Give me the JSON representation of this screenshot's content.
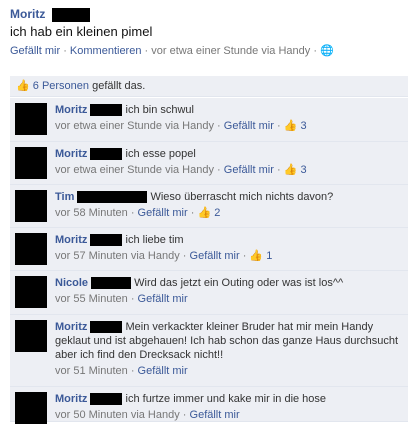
{
  "post": {
    "author": "Moritz",
    "text": "ich hab ein kleinen pimel",
    "like_action": "Gefällt mir",
    "comment_action": "Kommentieren",
    "time": "vor etwa einer Stunde via Handy"
  },
  "likes_summary": {
    "count_link": "6 Personen",
    "suffix": "gefällt das."
  },
  "comments": [
    {
      "author": "Moritz",
      "text": "ich bin schwul",
      "time": "vor etwa einer Stunde via Handy",
      "like": "Gefällt mir",
      "likes": "3"
    },
    {
      "author": "Moritz",
      "text": "ich esse popel",
      "time": "vor etwa einer Stunde via Handy",
      "like": "Gefällt mir",
      "likes": "3"
    },
    {
      "author": "Tim",
      "text": "Wieso überrascht mich nichts davon?",
      "time": "vor 58 Minuten",
      "like": "Gefällt mir",
      "likes": "2"
    },
    {
      "author": "Moritz",
      "text": "ich liebe tim",
      "time": "vor 57 Minuten via Handy",
      "like": "Gefällt mir",
      "likes": "1"
    },
    {
      "author": "Nicole",
      "text": "Wird das jetzt ein Outing oder was ist los^^",
      "time": "vor 55 Minuten",
      "like": "Gefällt mir",
      "likes": ""
    },
    {
      "author": "Moritz",
      "text": "Mein verkackter kleiner Bruder hat mir mein Handy geklaut und ist abgehauen! Ich hab schon das ganze Haus durchsucht aber ich find den Drecksack nicht!!",
      "time": "vor 51 Minuten",
      "like": "Gefällt mir",
      "likes": ""
    },
    {
      "author": "Moritz",
      "text": "ich furtze immer und kake mir in die hose",
      "time": "vor 50 Minuten via Handy",
      "like": "Gefällt mir",
      "likes": ""
    }
  ]
}
